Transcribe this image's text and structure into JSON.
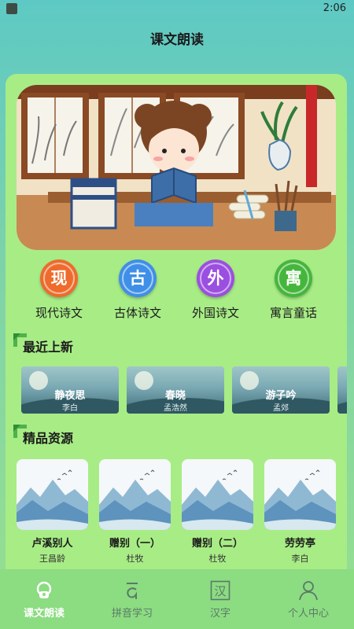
{
  "status_bar": {
    "time": "2:06"
  },
  "app": {
    "title": "课文朗读"
  },
  "categories": [
    {
      "glyph": "现",
      "label": "现代诗文",
      "color": "#ee6b2c",
      "icon": "modern-poetry-icon"
    },
    {
      "glyph": "古",
      "label": "古体诗文",
      "color": "#3f8fe8",
      "icon": "classical-poetry-icon"
    },
    {
      "glyph": "外",
      "label": "外国诗文",
      "color": "#9b4fe0",
      "icon": "foreign-poetry-icon"
    },
    {
      "glyph": "寓",
      "label": "寓言童话",
      "color": "#45b63c",
      "icon": "fable-icon"
    }
  ],
  "recent": {
    "title": "最近上新",
    "items": [
      {
        "title": "静夜思",
        "author": "李白"
      },
      {
        "title": "春晓",
        "author": "孟浩然"
      },
      {
        "title": "游子吟",
        "author": "孟郊"
      }
    ]
  },
  "featured": {
    "title": "精品资源",
    "items": [
      {
        "title": "卢溪别人",
        "author": "王昌龄"
      },
      {
        "title": "赠别（一）",
        "author": "杜牧"
      },
      {
        "title": "赠别（二）",
        "author": "杜牧"
      },
      {
        "title": "劳劳亭",
        "author": "李白"
      }
    ]
  },
  "tabs": [
    {
      "label": "课文朗读",
      "icon": "reading-icon",
      "active": true
    },
    {
      "label": "拼音学习",
      "icon": "pinyin-icon",
      "active": false
    },
    {
      "label": "汉字",
      "icon": "hanzi-icon",
      "active": false
    },
    {
      "label": "个人中心",
      "icon": "profile-icon",
      "active": false
    }
  ],
  "colors": {
    "accent_green": "#4fb24a",
    "card_bg": "#a8ec86",
    "tabbar_bg": "#8cdc82"
  }
}
